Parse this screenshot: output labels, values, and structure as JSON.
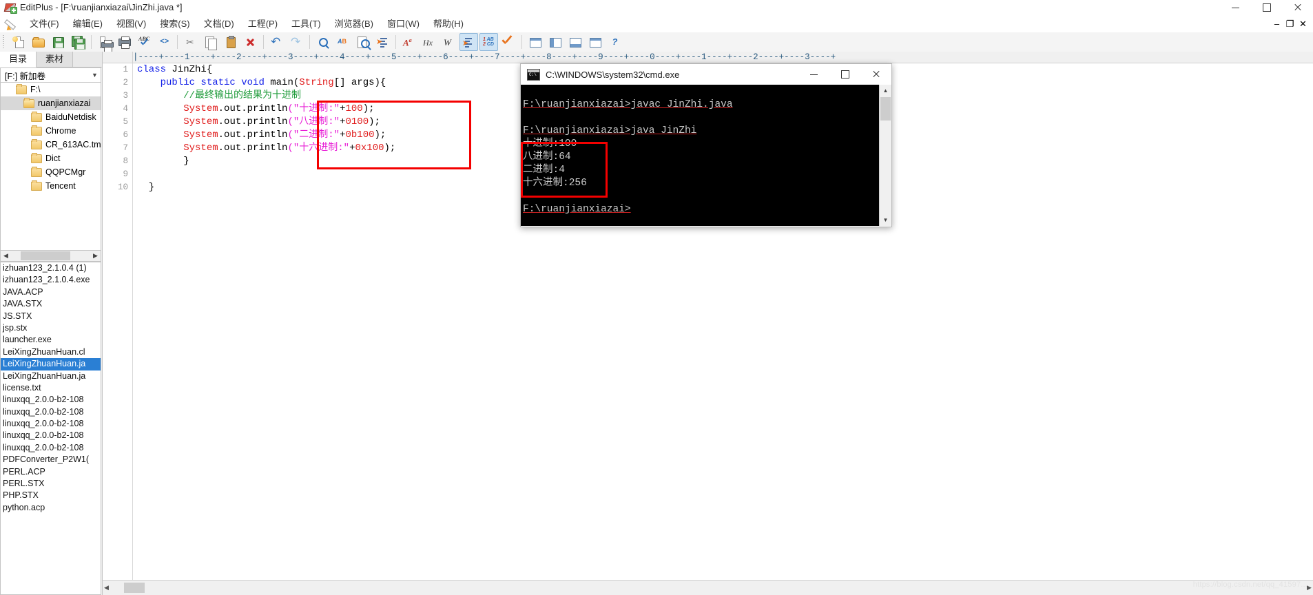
{
  "window": {
    "title": "EditPlus - [F:\\ruanjianxiazai\\JinZhi.java *]",
    "app_icon": "editplus-icon",
    "minimize_label": "Minimize",
    "maximize_label": "Maximize",
    "close_label": "Close"
  },
  "menubar": {
    "pencil_icon": "pencil-icon",
    "items": [
      {
        "label": "文件(F)"
      },
      {
        "label": "编辑(E)"
      },
      {
        "label": "视图(V)"
      },
      {
        "label": "搜索(S)"
      },
      {
        "label": "文档(D)"
      },
      {
        "label": "工程(P)"
      },
      {
        "label": "工具(T)"
      },
      {
        "label": "浏览器(B)"
      },
      {
        "label": "窗口(W)"
      },
      {
        "label": "帮助(H)"
      }
    ],
    "doc_minimize": "–",
    "doc_restore": "❐",
    "doc_close": "✕"
  },
  "toolbar": {
    "buttons": [
      {
        "name": "new-file",
        "label": "新建"
      },
      {
        "name": "open-file",
        "label": "打开"
      },
      {
        "name": "save-file",
        "label": "保存"
      },
      {
        "name": "save-all",
        "label": "全部保存"
      },
      {
        "name": "print-preview",
        "label": "打印预览"
      },
      {
        "name": "print",
        "label": "打印"
      },
      {
        "name": "spell-check",
        "label": "拼写检查"
      },
      {
        "name": "view-source",
        "label": "查看源代码"
      },
      {
        "name": "cut",
        "label": "剪切"
      },
      {
        "name": "copy",
        "label": "复制"
      },
      {
        "name": "paste",
        "label": "粘贴"
      },
      {
        "name": "delete",
        "label": "删除"
      },
      {
        "name": "undo",
        "label": "撤销"
      },
      {
        "name": "redo",
        "label": "重做"
      },
      {
        "name": "find",
        "label": "查找"
      },
      {
        "name": "replace",
        "label": "替换"
      },
      {
        "name": "find-in-files",
        "label": "在文件中查找"
      },
      {
        "name": "goto-line",
        "label": "转到行"
      },
      {
        "name": "font-format",
        "label": "字体"
      },
      {
        "name": "hex-view",
        "label": "十六进制查看"
      },
      {
        "name": "word-wrap",
        "label": "自动换行"
      },
      {
        "name": "align",
        "label": "对齐"
      },
      {
        "name": "sort",
        "label": "排序"
      },
      {
        "name": "compile-run",
        "label": "运行"
      },
      {
        "name": "toolbar-window-1",
        "label": "窗口平铺"
      },
      {
        "name": "toolbar-window-2",
        "label": "窗口拆分"
      },
      {
        "name": "toolbar-window-3",
        "label": "窗口水平"
      },
      {
        "name": "toolbar-window-4",
        "label": "窗口垂直"
      },
      {
        "name": "help",
        "label": "帮助"
      }
    ]
  },
  "sidebar": {
    "tabs": [
      {
        "label": "目录",
        "selected": true
      },
      {
        "label": "素材",
        "selected": false
      }
    ],
    "drive": {
      "value": "[F:] 新加卷",
      "dropdown_icon": "chevron-down-icon"
    },
    "tree": [
      {
        "label": "F:\\",
        "indent": 1,
        "selected": false
      },
      {
        "label": "ruanjianxiazai",
        "indent": 2,
        "selected": true
      },
      {
        "label": "BaiduNetdisk",
        "indent": 3,
        "selected": false
      },
      {
        "label": "Chrome",
        "indent": 3,
        "selected": false
      },
      {
        "label": "CR_613AC.tm",
        "indent": 3,
        "selected": false
      },
      {
        "label": "Dict",
        "indent": 3,
        "selected": false
      },
      {
        "label": "QQPCMgr",
        "indent": 3,
        "selected": false
      },
      {
        "label": "Tencent",
        "indent": 3,
        "selected": false
      }
    ],
    "scroll_left_icon": "chevron-left-icon",
    "scroll_right_icon": "chevron-right-icon",
    "files": [
      {
        "name": "izhuan123_2.1.0.4 (1)",
        "selected": false
      },
      {
        "name": "izhuan123_2.1.0.4.exe",
        "selected": false
      },
      {
        "name": "JAVA.ACP",
        "selected": false
      },
      {
        "name": "JAVA.STX",
        "selected": false
      },
      {
        "name": "JS.STX",
        "selected": false
      },
      {
        "name": "jsp.stx",
        "selected": false
      },
      {
        "name": "launcher.exe",
        "selected": false
      },
      {
        "name": "LeiXingZhuanHuan.cl",
        "selected": false
      },
      {
        "name": "LeiXingZhuanHuan.ja",
        "selected": true
      },
      {
        "name": "LeiXingZhuanHuan.ja",
        "selected": false
      },
      {
        "name": "license.txt",
        "selected": false
      },
      {
        "name": "linuxqq_2.0.0-b2-108",
        "selected": false
      },
      {
        "name": "linuxqq_2.0.0-b2-108",
        "selected": false
      },
      {
        "name": "linuxqq_2.0.0-b2-108",
        "selected": false
      },
      {
        "name": "linuxqq_2.0.0-b2-108",
        "selected": false
      },
      {
        "name": "linuxqq_2.0.0-b2-108",
        "selected": false
      },
      {
        "name": "PDFConverter_P2W1(",
        "selected": false
      },
      {
        "name": "PERL.ACP",
        "selected": false
      },
      {
        "name": "PERL.STX",
        "selected": false
      },
      {
        "name": "PHP.STX",
        "selected": false
      },
      {
        "name": "python.acp",
        "selected": false
      }
    ]
  },
  "editor": {
    "ruler": "|----+----1----+----2----+----3----+----4----+----5----+----6----+----7----+----8----+----9----+----0----+----1----+----2----+----3----+",
    "line_numbers": [
      "1",
      "2",
      "3",
      "4",
      "5",
      "6",
      "7",
      "8",
      "9",
      "10"
    ],
    "lines": [
      {
        "n": 1,
        "tokens": [
          {
            "t": "class ",
            "c": "kw"
          },
          {
            "t": "JinZhi{",
            "c": "plain"
          }
        ]
      },
      {
        "n": 2,
        "tokens": [
          {
            "t": "    ",
            "c": "plain"
          },
          {
            "t": "public ",
            "c": "kw"
          },
          {
            "t": "static ",
            "c": "kw"
          },
          {
            "t": "void ",
            "c": "kw"
          },
          {
            "t": "main(",
            "c": "plain"
          },
          {
            "t": "String",
            "c": "cls"
          },
          {
            "t": "[] args){",
            "c": "plain"
          }
        ]
      },
      {
        "n": 3,
        "tokens": [
          {
            "t": "        ",
            "c": "plain"
          },
          {
            "t": "//最终输出的结果为十进制",
            "c": "cmt"
          }
        ]
      },
      {
        "n": 4,
        "tokens": [
          {
            "t": "        ",
            "c": "plain"
          },
          {
            "t": "System",
            "c": "cls"
          },
          {
            "t": ".out.println",
            "c": "plain"
          },
          {
            "t": "(",
            "c": "paren"
          },
          {
            "t": "\"十进制:\"",
            "c": "str"
          },
          {
            "t": "+",
            "c": "plain"
          },
          {
            "t": "100",
            "c": "num"
          },
          {
            "t": ");",
            "c": "plain"
          }
        ]
      },
      {
        "n": 5,
        "tokens": [
          {
            "t": "        ",
            "c": "plain"
          },
          {
            "t": "System",
            "c": "cls"
          },
          {
            "t": ".out.println",
            "c": "plain"
          },
          {
            "t": "(",
            "c": "paren"
          },
          {
            "t": "\"八进制:\"",
            "c": "str"
          },
          {
            "t": "+",
            "c": "plain"
          },
          {
            "t": "0100",
            "c": "num"
          },
          {
            "t": ");",
            "c": "plain"
          }
        ]
      },
      {
        "n": 6,
        "tokens": [
          {
            "t": "        ",
            "c": "plain"
          },
          {
            "t": "System",
            "c": "cls"
          },
          {
            "t": ".out.println",
            "c": "plain"
          },
          {
            "t": "(",
            "c": "paren"
          },
          {
            "t": "\"二进制:\"",
            "c": "str"
          },
          {
            "t": "+",
            "c": "plain"
          },
          {
            "t": "0b100",
            "c": "num"
          },
          {
            "t": ");",
            "c": "plain"
          }
        ]
      },
      {
        "n": 7,
        "tokens": [
          {
            "t": "        ",
            "c": "plain"
          },
          {
            "t": "System",
            "c": "cls"
          },
          {
            "t": ".out.println",
            "c": "plain"
          },
          {
            "t": "(",
            "c": "paren"
          },
          {
            "t": "\"十六进制:\"",
            "c": "str"
          },
          {
            "t": "+",
            "c": "plain"
          },
          {
            "t": "0x100",
            "c": "num"
          },
          {
            "t": ");",
            "c": "plain"
          }
        ]
      },
      {
        "n": 8,
        "tokens": [
          {
            "t": "        }",
            "c": "plain"
          }
        ]
      },
      {
        "n": 9,
        "tokens": [
          {
            "t": "",
            "c": "plain"
          }
        ]
      },
      {
        "n": 10,
        "tokens": [
          {
            "t": "  }",
            "c": "plain"
          }
        ]
      }
    ],
    "highlight_color": "#f40000",
    "scroll_left_icon": "chevron-left-icon",
    "scroll_right_icon": "chevron-right-icon"
  },
  "cmd": {
    "title": "C:\\WINDOWS\\system32\\cmd.exe",
    "icon": "console-icon",
    "minimize_label": "–",
    "maximize_label": "☐",
    "close_label": "✕",
    "lines": [
      {
        "text": "F:\\ruanjianxiazai>javac JinZhi.java",
        "prompt": true
      },
      {
        "text": "",
        "prompt": false
      },
      {
        "text": "F:\\ruanjianxiazai>java JinZhi",
        "prompt": true
      },
      {
        "text": "十进制:100",
        "prompt": false
      },
      {
        "text": "八进制:64",
        "prompt": false
      },
      {
        "text": "二进制:4",
        "prompt": false
      },
      {
        "text": "十六进制:256",
        "prompt": false
      },
      {
        "text": "",
        "prompt": false
      },
      {
        "text": "F:\\ruanjianxiazai>",
        "prompt": true
      }
    ],
    "scroll_up_icon": "chevron-up-icon",
    "scroll_down_icon": "chevron-down-icon",
    "highlight_color": "#f40000"
  },
  "watermark": {
    "text": "https://blog.csdn.net/qq_41597..."
  }
}
